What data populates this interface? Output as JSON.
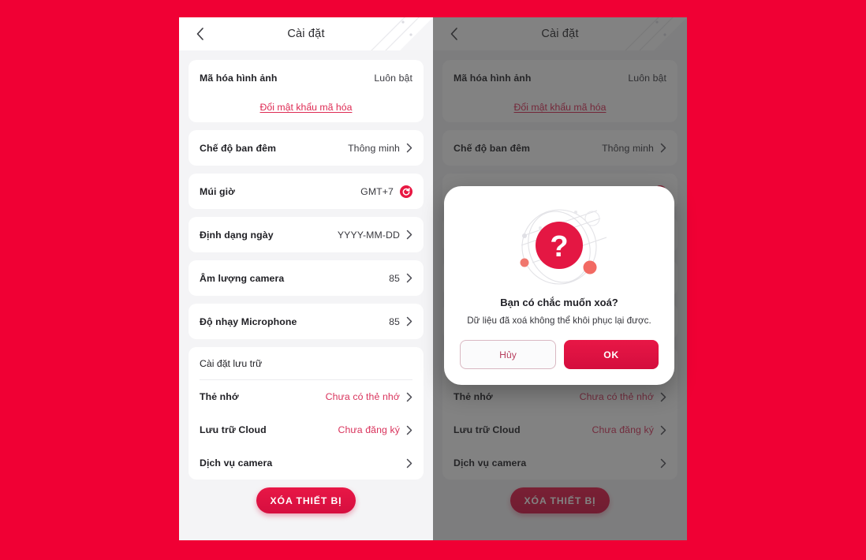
{
  "theme": {
    "page_background": "#F00034",
    "panel_background": "#F4F4F6",
    "card_background": "#FFFFFF",
    "accent_red": "#E81746",
    "link_red": "#DE2A53",
    "muted_red": "#D9335C"
  },
  "header": {
    "title": "Cài đặt",
    "back_icon": "chevron-left-icon"
  },
  "settings": {
    "encryption": {
      "label": "Mã hóa hình ảnh",
      "value": "Luôn bật",
      "link": "Đổi mật khẩu mã hóa"
    },
    "rows": [
      {
        "label": "Chế độ ban đêm",
        "value": "Thông minh",
        "icon": "chevron-right-icon"
      },
      {
        "label": "Múi giờ",
        "value": "GMT+7",
        "icon": "sync-icon"
      },
      {
        "label": "Định dạng ngày",
        "value": "YYYY-MM-DD",
        "icon": "chevron-right-icon"
      },
      {
        "label": "Âm lượng camera",
        "value": "85",
        "icon": "chevron-right-icon"
      },
      {
        "label": "Độ nhạy Microphone",
        "value": "85",
        "icon": "chevron-right-icon"
      }
    ],
    "storage": {
      "title": "Cài đặt lưu trữ",
      "rows": [
        {
          "label": "Thẻ nhớ",
          "value": "Chưa có thẻ nhớ",
          "icon": "chevron-right-icon"
        },
        {
          "label": "Lưu trữ Cloud",
          "value": "Chưa đăng ký",
          "icon": "chevron-right-icon"
        },
        {
          "label": "Dịch vụ camera",
          "value": "",
          "icon": "chevron-right-icon"
        }
      ]
    },
    "delete_button": "XÓA THIẾT BỊ"
  },
  "modal": {
    "illustration": "question-mark-icon",
    "title": "Bạn có chắc muốn xoá?",
    "subtitle": "Dữ liệu đã xoá không thể khôi phục lại được.",
    "cancel_label": "Hủy",
    "ok_label": "OK"
  }
}
